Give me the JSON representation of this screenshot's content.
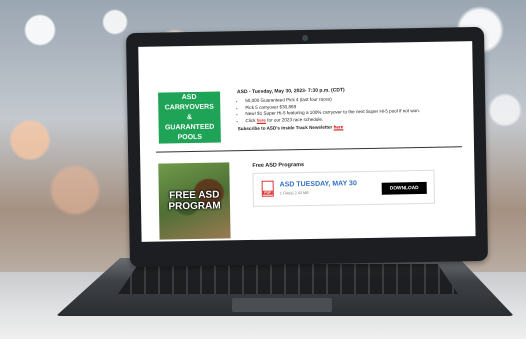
{
  "hero_badge": {
    "text": "ASD CARRYOVERS & GUARANTEED POOLS",
    "color": "#1fa357"
  },
  "news": {
    "heading": "ASD - Tuesday, May 30, 2023- 7:30 p.m. (CDT)",
    "items": [
      "50,000 Guaranteed Pick 4 (last four races)",
      "Pick 5 carryover $30,869",
      "New! $1 Super Hi-5 featuring a 100% carryover to the next Super Hi-5 pool if not won.",
      "for our 2023 race schedule."
    ],
    "item4_prefix": "Click",
    "item4_link": "here",
    "subscribe_text": "Subscribe to ASD's Inside Track Newsletter",
    "subscribe_link": "here"
  },
  "promo_image": {
    "text": "FREE ASD PROGRAM"
  },
  "programs": {
    "title": "Free ASD Programs",
    "item_name": "ASD TUESDAY, MAY 30",
    "item_meta": "1 File(s)   2.43 MB",
    "download_label": "DOWNLOAD"
  },
  "colors": {
    "link": "#cc0000",
    "program_link": "#2f6fc4",
    "download_bg": "#000000"
  }
}
